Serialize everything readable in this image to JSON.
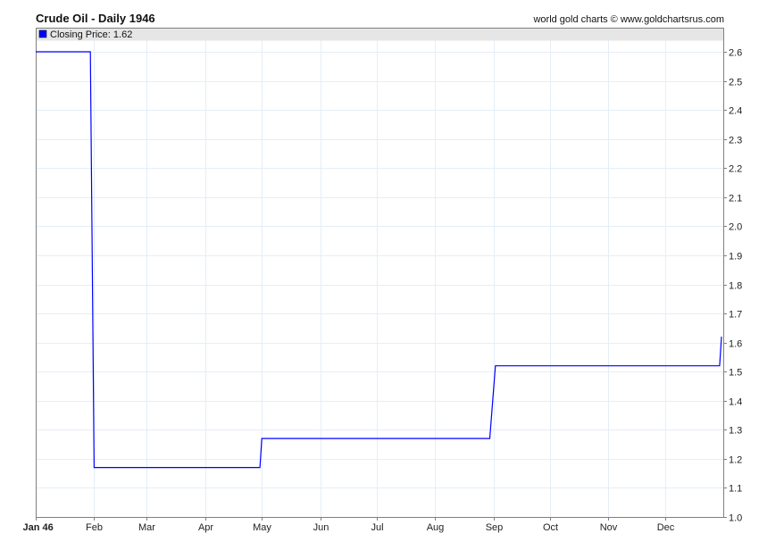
{
  "chart_data": {
    "type": "line",
    "title": "Crude Oil - Daily 1946",
    "credit": "world gold charts © www.goldchartsrus.com",
    "legend": {
      "label": "Closing Price: 1.62",
      "color": "#0000ff",
      "placement": "top-left"
    },
    "series": [
      {
        "name": "Closing Price",
        "color": "#0000ff",
        "points": [
          [
            "1946-01-01",
            2.6
          ],
          [
            "1946-01-30",
            2.6
          ],
          [
            "1946-02-01",
            1.17
          ],
          [
            "1946-04-30",
            1.17
          ],
          [
            "1946-05-01",
            1.27
          ],
          [
            "1946-08-30",
            1.27
          ],
          [
            "1946-09-02",
            1.52
          ],
          [
            "1946-12-30",
            1.52
          ],
          [
            "1946-12-31",
            1.62
          ]
        ]
      }
    ],
    "x_range": [
      "1946-01-01",
      "1946-12-31"
    ],
    "x_ticks": [
      {
        "date": "1946-01-01",
        "label": "Jan 46"
      },
      {
        "date": "1946-02-01",
        "label": "Feb"
      },
      {
        "date": "1946-03-01",
        "label": "Mar"
      },
      {
        "date": "1946-04-01",
        "label": "Apr"
      },
      {
        "date": "1946-05-01",
        "label": "May"
      },
      {
        "date": "1946-06-01",
        "label": "Jun"
      },
      {
        "date": "1946-07-01",
        "label": "Jul"
      },
      {
        "date": "1946-08-01",
        "label": "Aug"
      },
      {
        "date": "1946-09-01",
        "label": "Sep"
      },
      {
        "date": "1946-10-01",
        "label": "Oct"
      },
      {
        "date": "1946-11-01",
        "label": "Nov"
      },
      {
        "date": "1946-12-01",
        "label": "Dec"
      }
    ],
    "ylim": [
      1.0,
      2.6
    ],
    "y_ticks": [
      "1.0",
      "1.1",
      "1.2",
      "1.3",
      "1.4",
      "1.5",
      "1.6",
      "1.7",
      "1.8",
      "1.9",
      "2.0",
      "2.1",
      "2.2",
      "2.3",
      "2.4",
      "2.5",
      "2.6"
    ],
    "grid": true,
    "colors": {
      "grid": "#e4eef8",
      "axis": "#808080",
      "legend_bg": "#e6e6e6"
    }
  }
}
